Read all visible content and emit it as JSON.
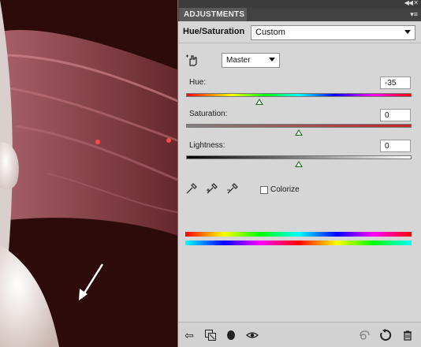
{
  "panel": {
    "tab_label": "ADJUSTMENTS",
    "adjustment_title": "Hue/Saturation",
    "preset_value": "Custom",
    "channel_value": "Master"
  },
  "sliders": {
    "hue": {
      "label": "Hue:",
      "value": "-35",
      "position": 0.325
    },
    "saturation": {
      "label": "Saturation:",
      "value": "0",
      "position": 0.5
    },
    "lightness": {
      "label": "Lightness:",
      "value": "0",
      "position": 0.5
    }
  },
  "colorize": {
    "label": "Colorize",
    "checked": false
  },
  "colors": {
    "thumb": "#1d6b1f",
    "panel_bg": "#d6d6d6",
    "tab_bg": "#5a5a5a"
  },
  "icons": {
    "top": [
      "collapse-arrows-icon",
      "close-icon",
      "panel-menu-icon"
    ],
    "tools": [
      "on-image-adjust-hand-icon",
      "eyedropper-icon",
      "eyedropper-plus-icon",
      "eyedropper-minus-icon"
    ],
    "bottom": [
      "return-arrow-icon",
      "clip-to-layer-icon",
      "layer-visibility-circle-icon",
      "eye-icon",
      "view-previous-icon",
      "reset-icon",
      "trash-icon"
    ]
  }
}
